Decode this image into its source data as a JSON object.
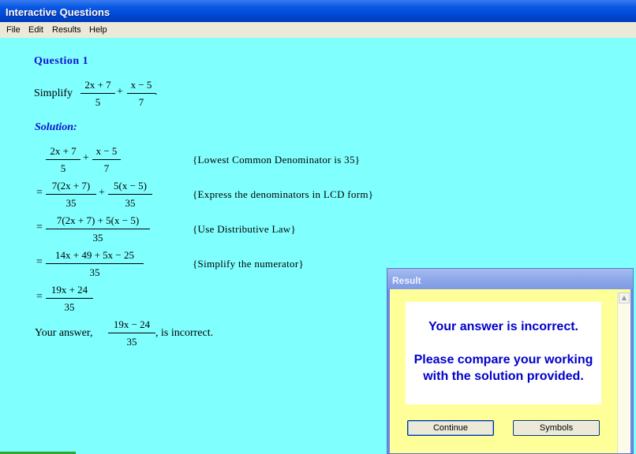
{
  "window": {
    "title": "Interactive Questions"
  },
  "menu": [
    "File",
    "Edit",
    "Results",
    "Help"
  ],
  "question": {
    "heading": "Question 1",
    "prompt_word": "Simplify",
    "frac1": {
      "num": "2x + 7",
      "den": "5"
    },
    "plus": "+",
    "frac2": {
      "num": "x − 5",
      "den": "7"
    },
    "end": "."
  },
  "solution": {
    "heading": "Solution:",
    "steps": [
      {
        "lead": "",
        "comment": "{Lowest Common Denominator is 35}",
        "f1": {
          "num": "2x + 7",
          "den": "5"
        },
        "op": "+",
        "f2": {
          "num": "x − 5",
          "den": "7"
        }
      },
      {
        "lead": "=",
        "comment": "{Express the denominators in LCD form}",
        "f1": {
          "num": "7(2x + 7)",
          "den": "35"
        },
        "op": "+",
        "f2": {
          "num": "5(x − 5)",
          "den": "35"
        }
      },
      {
        "lead": "=",
        "comment": "{Use Distributive Law}",
        "f1": {
          "num": "7(2x + 7) + 5(x − 5)",
          "den": "35"
        }
      },
      {
        "lead": "=",
        "comment": "{Simplify the numerator}",
        "f1": {
          "num": "14x + 49 + 5x − 25",
          "den": "35"
        }
      },
      {
        "lead": "=",
        "comment": "",
        "f1": {
          "num": "19x + 24",
          "den": "35"
        }
      }
    ]
  },
  "feedback": {
    "prefix": "Your answer,",
    "answer": {
      "num": "19x − 24",
      "den": "35"
    },
    "suffix": ", is incorrect."
  },
  "dialog": {
    "title": "Result",
    "line1": "Your answer is incorrect.",
    "line2": "Please compare your working",
    "line3": "with the solution provided.",
    "continue_label": "Continue",
    "symbols_label": "Symbols",
    "scroll_up_icon": "chevron-up-icon"
  }
}
